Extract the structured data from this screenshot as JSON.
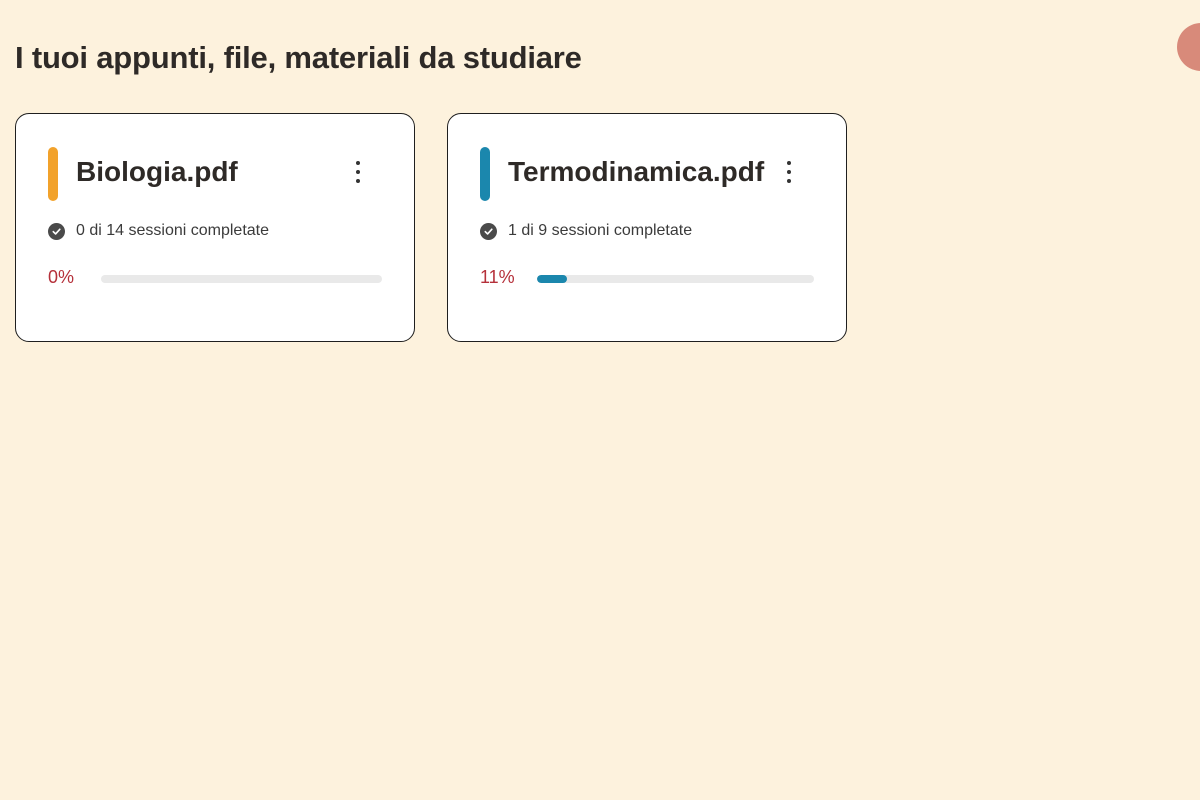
{
  "page": {
    "title": "I tuoi appunti, file, materiali da studiare"
  },
  "cards": [
    {
      "name": "Biologia.pdf",
      "sessions": "0 di 14 sessioni completate",
      "percent_label": "0%",
      "progress": 0,
      "accent": "#f2a22b"
    },
    {
      "name": "Termodinamica.pdf",
      "sessions": "1 di 9 sessioni completate",
      "percent_label": "11%",
      "progress": 0.11,
      "accent": "#1b87ad"
    }
  ],
  "colors": {
    "background": "#fdf2dd",
    "percent_text": "#b5303a",
    "avatar": "#d88a7a"
  },
  "icons": {
    "menu": "more-vertical-icon",
    "check": "check-circle-icon"
  }
}
